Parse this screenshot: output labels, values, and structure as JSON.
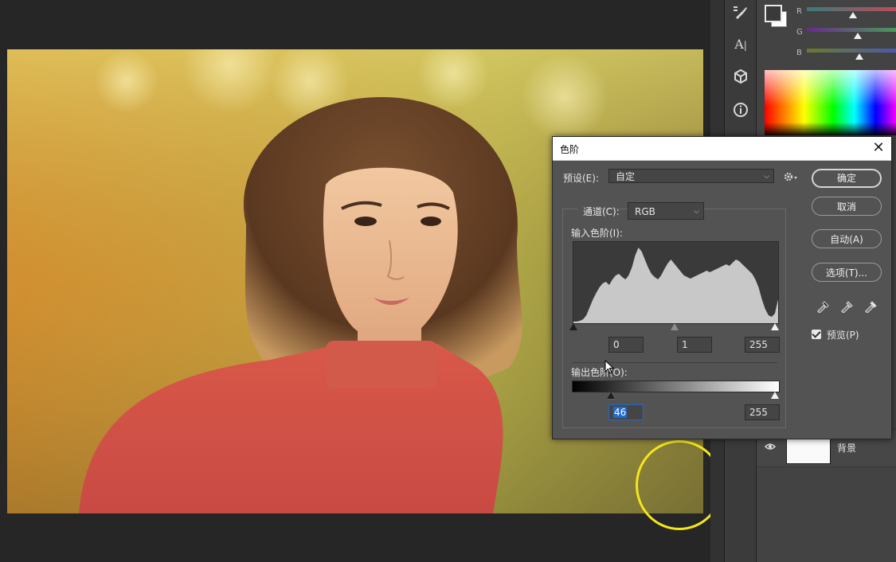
{
  "dialog": {
    "title": "色阶",
    "close_glyph": "✕",
    "preset_label": "预设(E):",
    "preset_value": "自定",
    "channel_label": "通道(C):",
    "channel_value": "RGB",
    "input_levels_label": "输入色阶(I):",
    "input_black": "0",
    "input_gamma": "1",
    "input_white": "255",
    "output_levels_label": "输出色阶(O):",
    "output_black": "46",
    "output_white": "255",
    "preview_label": "预览(P)",
    "preview_checked": true,
    "buttons": {
      "ok": "确定",
      "cancel": "取消",
      "auto": "自动(A)",
      "options": "选项(T)..."
    }
  },
  "color_panel": {
    "channels": [
      "R",
      "G",
      "B"
    ],
    "foreground_color": "#3a3a3a",
    "background_color": "#ffffff"
  },
  "layers": {
    "items": [
      {
        "name": "背景",
        "visible": true
      }
    ]
  },
  "histogram": [
    2,
    2,
    3,
    5,
    10,
    20,
    30,
    38,
    45,
    50,
    52,
    48,
    55,
    60,
    62,
    58,
    55,
    60,
    70,
    85,
    95,
    90,
    80,
    70,
    62,
    58,
    55,
    60,
    68,
    75,
    80,
    75,
    70,
    65,
    60,
    58,
    56,
    58,
    60,
    62,
    64,
    66,
    64,
    66,
    68,
    70,
    72,
    74,
    72,
    76,
    80,
    78,
    74,
    70,
    66,
    62,
    55,
    45,
    30,
    18,
    10,
    8,
    12,
    30
  ],
  "accent_colors": {
    "annotation_ring": "#f4e61c",
    "selection": "#1e6bd0"
  }
}
